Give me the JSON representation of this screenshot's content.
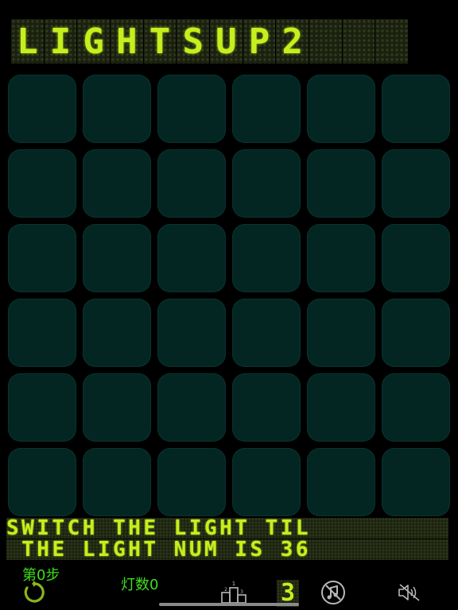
{
  "title_letters": [
    "L",
    "I",
    "G",
    "H",
    "T",
    "S",
    "U",
    "P",
    "2"
  ],
  "grid": {
    "rows": 6,
    "cols": 6,
    "lit": 0
  },
  "ticker": {
    "line1": "SWITCH THE LIGHT TIL",
    "line2": " THE LIGHT NUM IS 36"
  },
  "status": {
    "steps_label": "第0步",
    "lights_label": "灯数0",
    "level": "3"
  },
  "icons": {
    "restart": "restart-icon",
    "ranking": "podium-icon",
    "music": "music-off-icon",
    "sound": "speaker-muted-icon"
  },
  "colors": {
    "led_text": "#c5ef1e",
    "tile": "#042623",
    "status_text": "#3be01c"
  }
}
